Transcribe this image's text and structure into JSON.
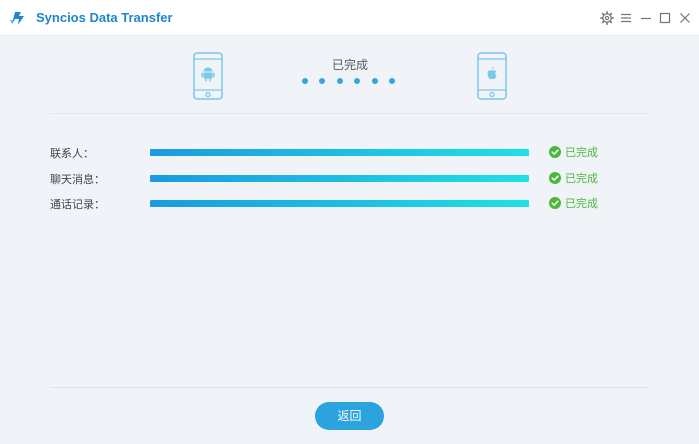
{
  "app": {
    "title": "Syncios Data Transfer",
    "brand_color": "#1f86c9"
  },
  "window_controls": {
    "icons": [
      "gear-icon",
      "menu-icon",
      "minimize-icon",
      "maximize-icon",
      "close-icon"
    ]
  },
  "transfer": {
    "status_title": "已完成",
    "source_device_icon": "android-phone-icon",
    "target_device_icon": "apple-phone-icon",
    "items": [
      {
        "label": "联系人：",
        "progress": 1.0,
        "status": "已完成"
      },
      {
        "label": "聊天消息：",
        "progress": 1.0,
        "status": "已完成"
      },
      {
        "label": "通话记录：",
        "progress": 1.0,
        "status": "已完成"
      }
    ],
    "status_color": "#4bb839",
    "accent_color": "#2ba3df"
  },
  "footer": {
    "back_label": "返回"
  }
}
